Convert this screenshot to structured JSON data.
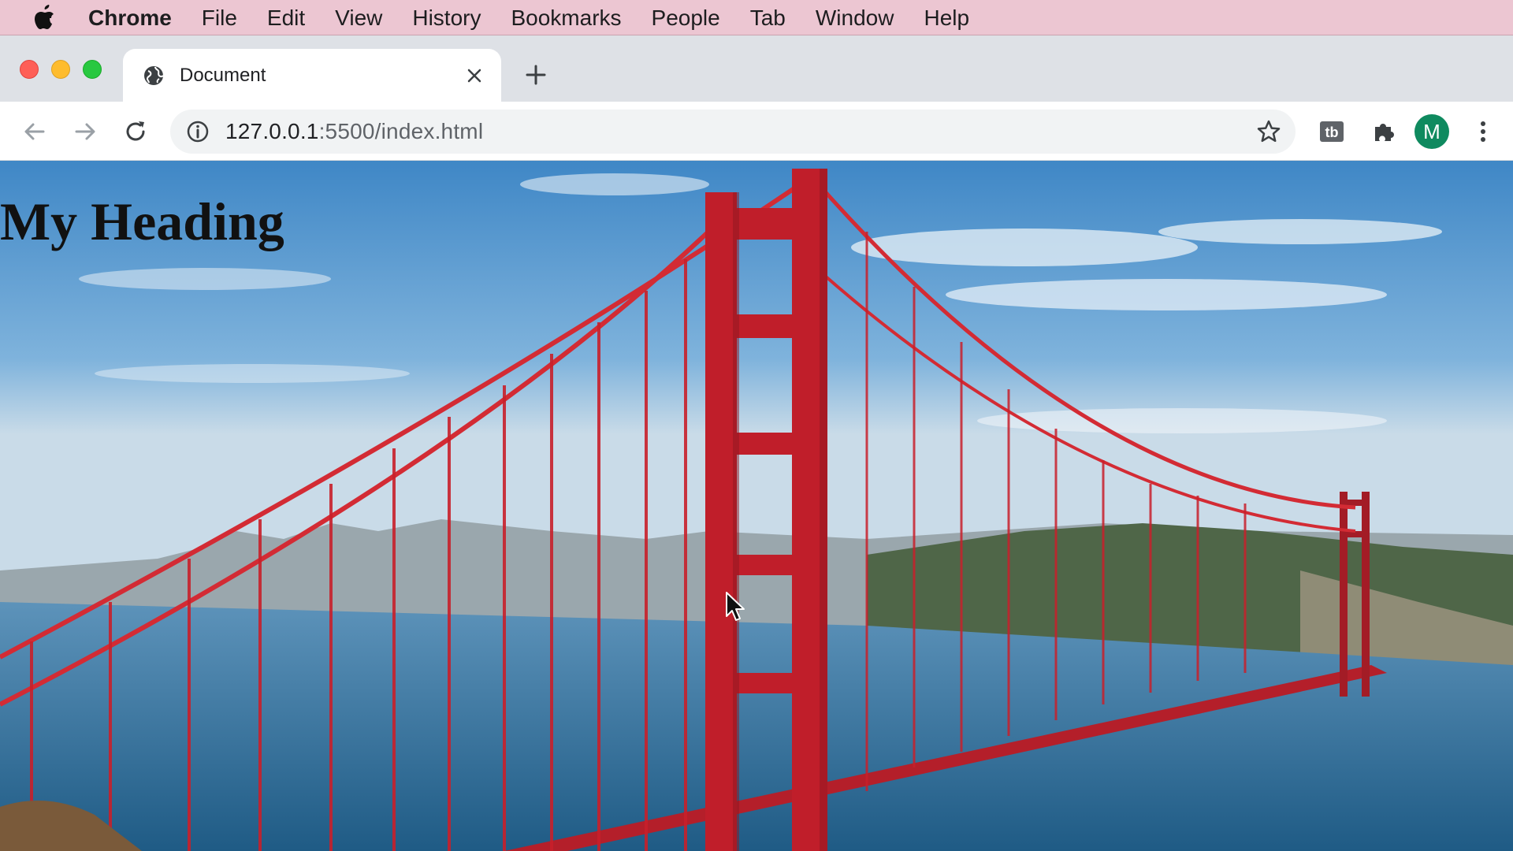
{
  "menubar": {
    "apple_icon": "apple-icon",
    "app_name": "Chrome",
    "items": [
      "File",
      "Edit",
      "View",
      "History",
      "Bookmarks",
      "People",
      "Tab",
      "Window",
      "Help"
    ]
  },
  "tab": {
    "title": "Document",
    "favicon": "globe-icon",
    "close_icon": "close-icon"
  },
  "new_tab_icon": "plus-icon",
  "toolbar": {
    "back_icon": "back-arrow-icon",
    "forward_icon": "forward-arrow-icon",
    "reload_icon": "reload-icon",
    "url_host": "127.0.0.1",
    "url_rest": ":5500/index.html",
    "info_icon": "info-icon",
    "bookmark_icon": "star-icon",
    "extension_1_icon": "tab-extension-icon",
    "extensions_icon": "puzzle-icon",
    "profile_initial": "M",
    "menu_icon": "kebab-menu-icon"
  },
  "page": {
    "heading": "My Heading"
  },
  "colors": {
    "menubar_bg": "#ecc6d2",
    "tabstrip_bg": "#dee1e6",
    "avatar_bg": "#0f8a5f",
    "bridge_red": "#c8202b",
    "sky": "#4f92c9",
    "water": "#2f6f9a"
  }
}
